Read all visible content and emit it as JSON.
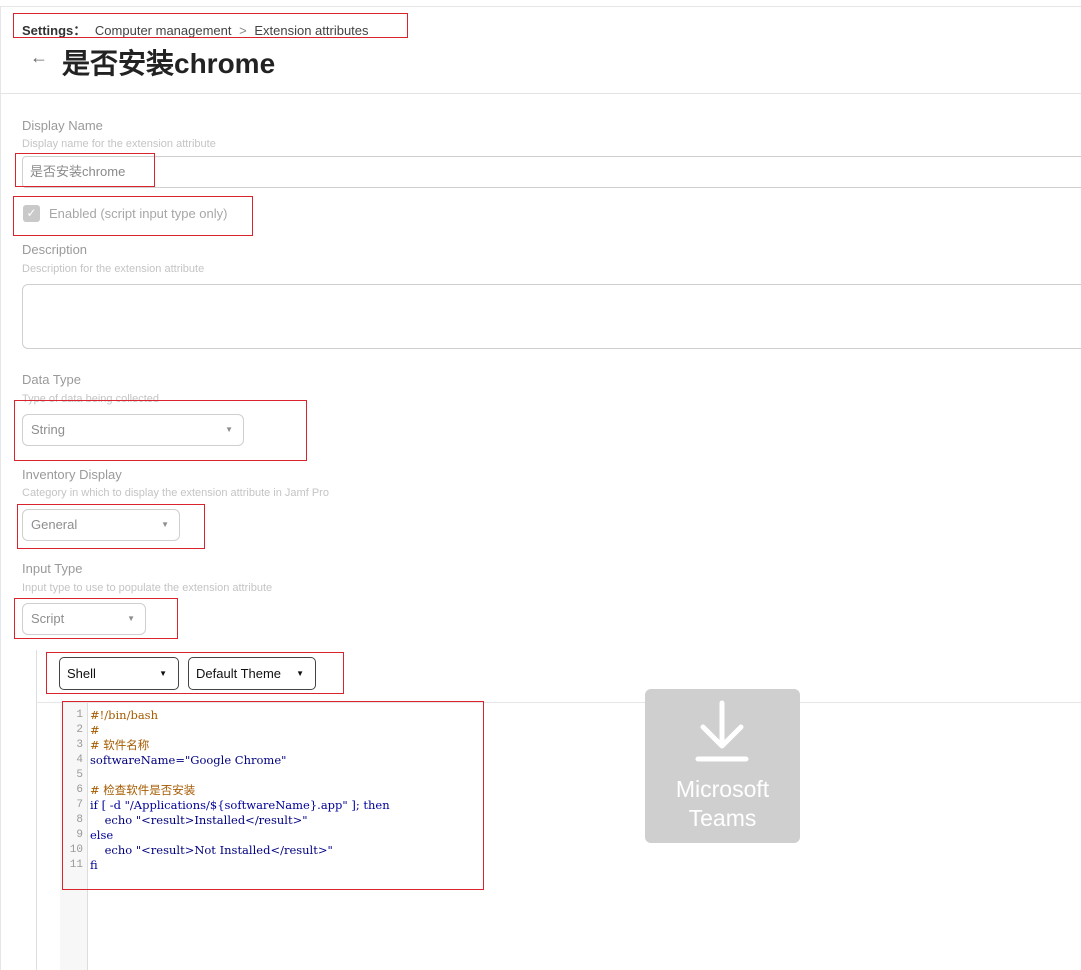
{
  "breadcrumb": {
    "root": "Settings：",
    "items": [
      "Computer management",
      "Extension attributes"
    ],
    "separator": ">"
  },
  "page": {
    "back_icon": "arrow-left-icon",
    "title": "是否安装chrome"
  },
  "form": {
    "display_name": {
      "label": "Display Name",
      "help": "Display name for the extension attribute",
      "value": "是否安装chrome"
    },
    "enabled": {
      "label": "Enabled (script input type only)",
      "checked": true
    },
    "description": {
      "label": "Description",
      "help": "Description for the extension attribute",
      "value": ""
    },
    "data_type": {
      "label": "Data Type",
      "help": "Type of data being collected",
      "value": "String"
    },
    "inventory_display": {
      "label": "Inventory Display",
      "help": "Category in which to display the extension attribute in Jamf Pro",
      "value": "General"
    },
    "input_type": {
      "label": "Input Type",
      "help": "Input type to use to populate the extension attribute",
      "value": "Script"
    }
  },
  "editor": {
    "language": "Shell",
    "theme": "Default Theme",
    "line_numbers": [
      "1",
      "2",
      "3",
      "4",
      "5",
      "6",
      "7",
      "8",
      "9",
      "10",
      "11"
    ],
    "lines": [
      "#!/bin/bash",
      "#",
      "# 软件名称",
      "softwareName=\"Google Chrome\"",
      "",
      "# 检查软件是否安装",
      "if [ -d \"/Applications/${softwareName}.app\" ]; then",
      "    echo \"<result>Installed</result>\"",
      "else",
      "    echo \"<result>Not Installed</result>\"",
      "fi"
    ]
  },
  "overlay": {
    "icon": "download-icon",
    "line1": "Microsoft",
    "line2": "Teams"
  },
  "colors": {
    "highlight_box": "#d9232d",
    "code_comment": "#a55b00",
    "code_string": "#7a1010",
    "code_plain": "#000080"
  }
}
